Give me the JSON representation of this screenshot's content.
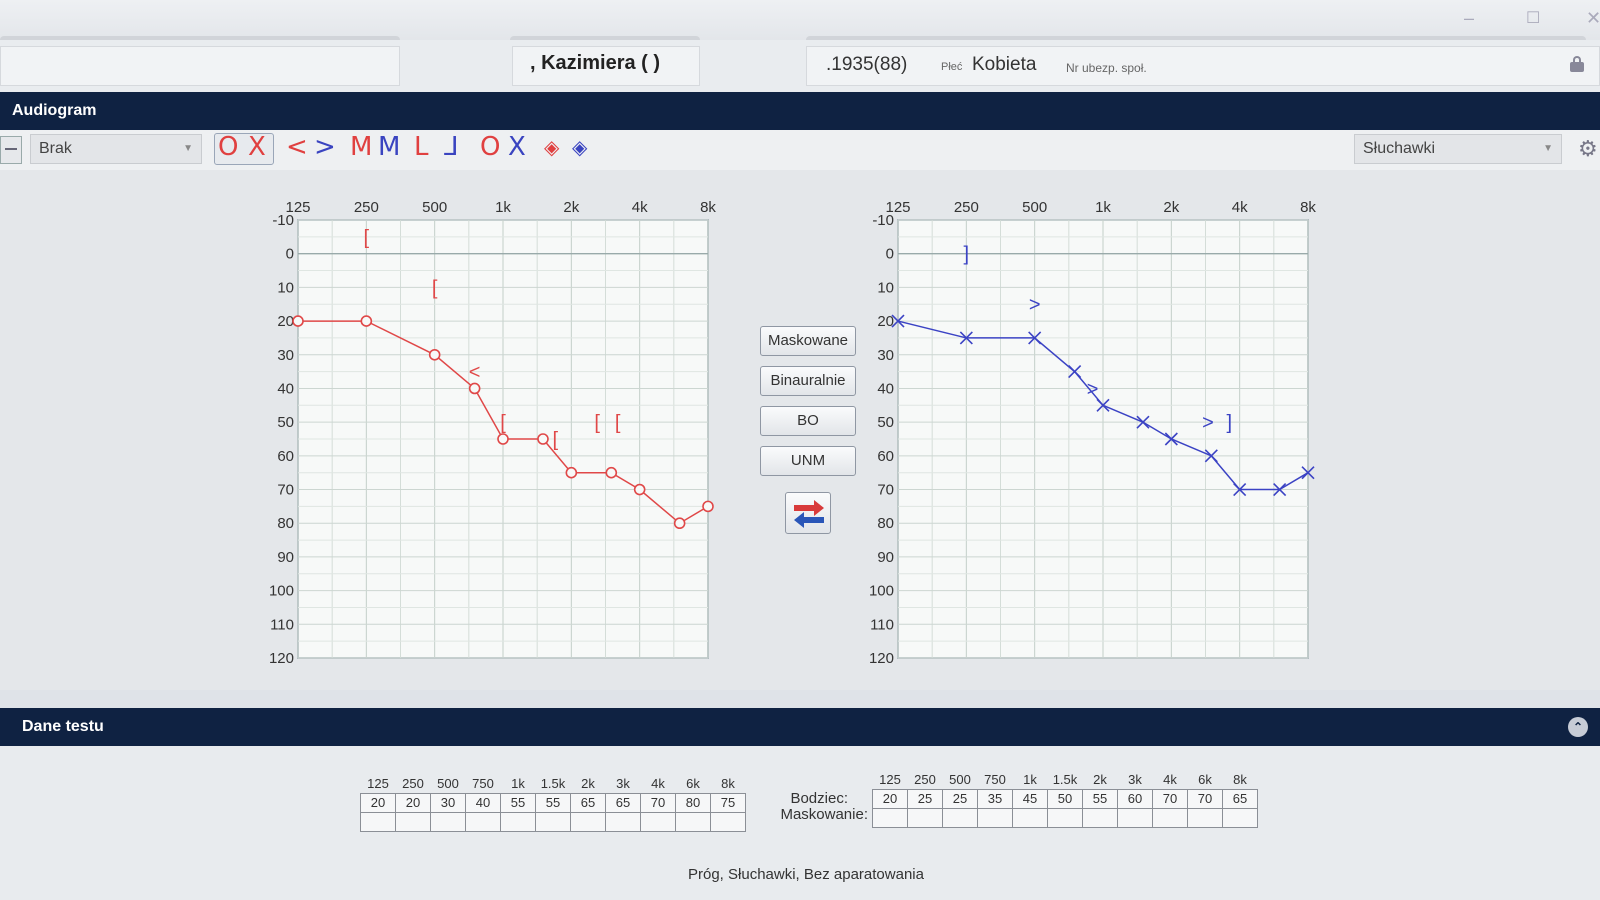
{
  "window": {
    "min_icon": "minimize-icon",
    "max_icon": "maximize-icon",
    "close_icon": "close-icon"
  },
  "patient": {
    "name": ", Kazimiera ( )",
    "dob": ".1935(88)",
    "sex_label": "Płeć",
    "sex": "Kobieta",
    "insurance_label": "Nr ubezp. społ."
  },
  "sections": {
    "audiogram": "Audiogram",
    "test": "Dane testu"
  },
  "toolbar": {
    "masking_select": "Brak",
    "transducer_select": "Słuchawki",
    "symbols": {
      "o": "O",
      "x": "X",
      "lt": "<",
      "gt": ">",
      "m1": "M",
      "m2": "M",
      "l": "L",
      "j": "⅃",
      "o2": "O",
      "x2": "X",
      "dr": "◈",
      "db": "◈"
    }
  },
  "buttons": {
    "masked": "Maskowane",
    "binaural": "Binauralnie",
    "bo": "BO",
    "unm": "UNM"
  },
  "colors": {
    "right": "#e04848",
    "left": "#3b43c4",
    "header": "#0f2242"
  },
  "chart_data": [
    {
      "type": "line",
      "title": "",
      "ear": "right",
      "x_ticks": [
        "125",
        "250",
        "500",
        "1k",
        "2k",
        "4k",
        "8k"
      ],
      "y_ticks": [
        "-10",
        "0",
        "10",
        "20",
        "30",
        "40",
        "50",
        "60",
        "70",
        "80",
        "90",
        "100",
        "110",
        "120"
      ],
      "ylim": [
        -10,
        120
      ],
      "y_inverted": true,
      "series": [
        {
          "symbol": "O",
          "color": "#e04848",
          "x": [
            125,
            250,
            500,
            750,
            1000,
            1500,
            2000,
            3000,
            4000,
            6000,
            8000
          ],
          "y": [
            20,
            20,
            30,
            40,
            55,
            55,
            65,
            65,
            70,
            80,
            75
          ]
        }
      ],
      "bone": [
        {
          "symbol": "<",
          "x": 750,
          "y": 35
        },
        {
          "symbol": "[",
          "x": 250,
          "y": -5
        },
        {
          "symbol": "[",
          "x": 500,
          "y": 10
        },
        {
          "symbol": "[",
          "x": 1000,
          "y": 50
        },
        {
          "symbol": "[",
          "x": 1700,
          "y": 55
        },
        {
          "symbol": "[",
          "x": 2600,
          "y": 50
        },
        {
          "symbol": "[",
          "x": 3200,
          "y": 50
        }
      ]
    },
    {
      "type": "line",
      "title": "",
      "ear": "left",
      "x_ticks": [
        "125",
        "250",
        "500",
        "1k",
        "2k",
        "4k",
        "8k"
      ],
      "y_ticks": [
        "-10",
        "0",
        "10",
        "20",
        "30",
        "40",
        "50",
        "60",
        "70",
        "80",
        "90",
        "100",
        "110",
        "120"
      ],
      "ylim": [
        -10,
        120
      ],
      "y_inverted": true,
      "series": [
        {
          "symbol": "X",
          "color": "#3b43c4",
          "x": [
            125,
            250,
            500,
            750,
            1000,
            1500,
            2000,
            3000,
            4000,
            6000,
            8000
          ],
          "y": [
            20,
            25,
            25,
            35,
            45,
            50,
            55,
            60,
            70,
            70,
            65
          ]
        }
      ],
      "bone": [
        {
          "symbol": "]",
          "x": 250,
          "y": 0
        },
        {
          "symbol": ">",
          "x": 500,
          "y": 15
        },
        {
          "symbol": ">",
          "x": 900,
          "y": 40
        },
        {
          "symbol": ">",
          "x": 2900,
          "y": 50
        },
        {
          "symbol": "]",
          "x": 3600,
          "y": 50
        }
      ]
    }
  ],
  "test_data": {
    "frequencies": [
      "125",
      "250",
      "500",
      "750",
      "1k",
      "1.5k",
      "2k",
      "3k",
      "4k",
      "6k",
      "8k"
    ],
    "right_values": [
      "20",
      "20",
      "30",
      "40",
      "55",
      "55",
      "65",
      "65",
      "70",
      "80",
      "75"
    ],
    "left_values": [
      "20",
      "25",
      "25",
      "35",
      "45",
      "50",
      "55",
      "60",
      "70",
      "70",
      "65"
    ],
    "stimulus_label": "Bodziec:",
    "masking_label": "Maskowanie:",
    "footer": "Próg, Słuchawki, Bez aparatowania"
  }
}
